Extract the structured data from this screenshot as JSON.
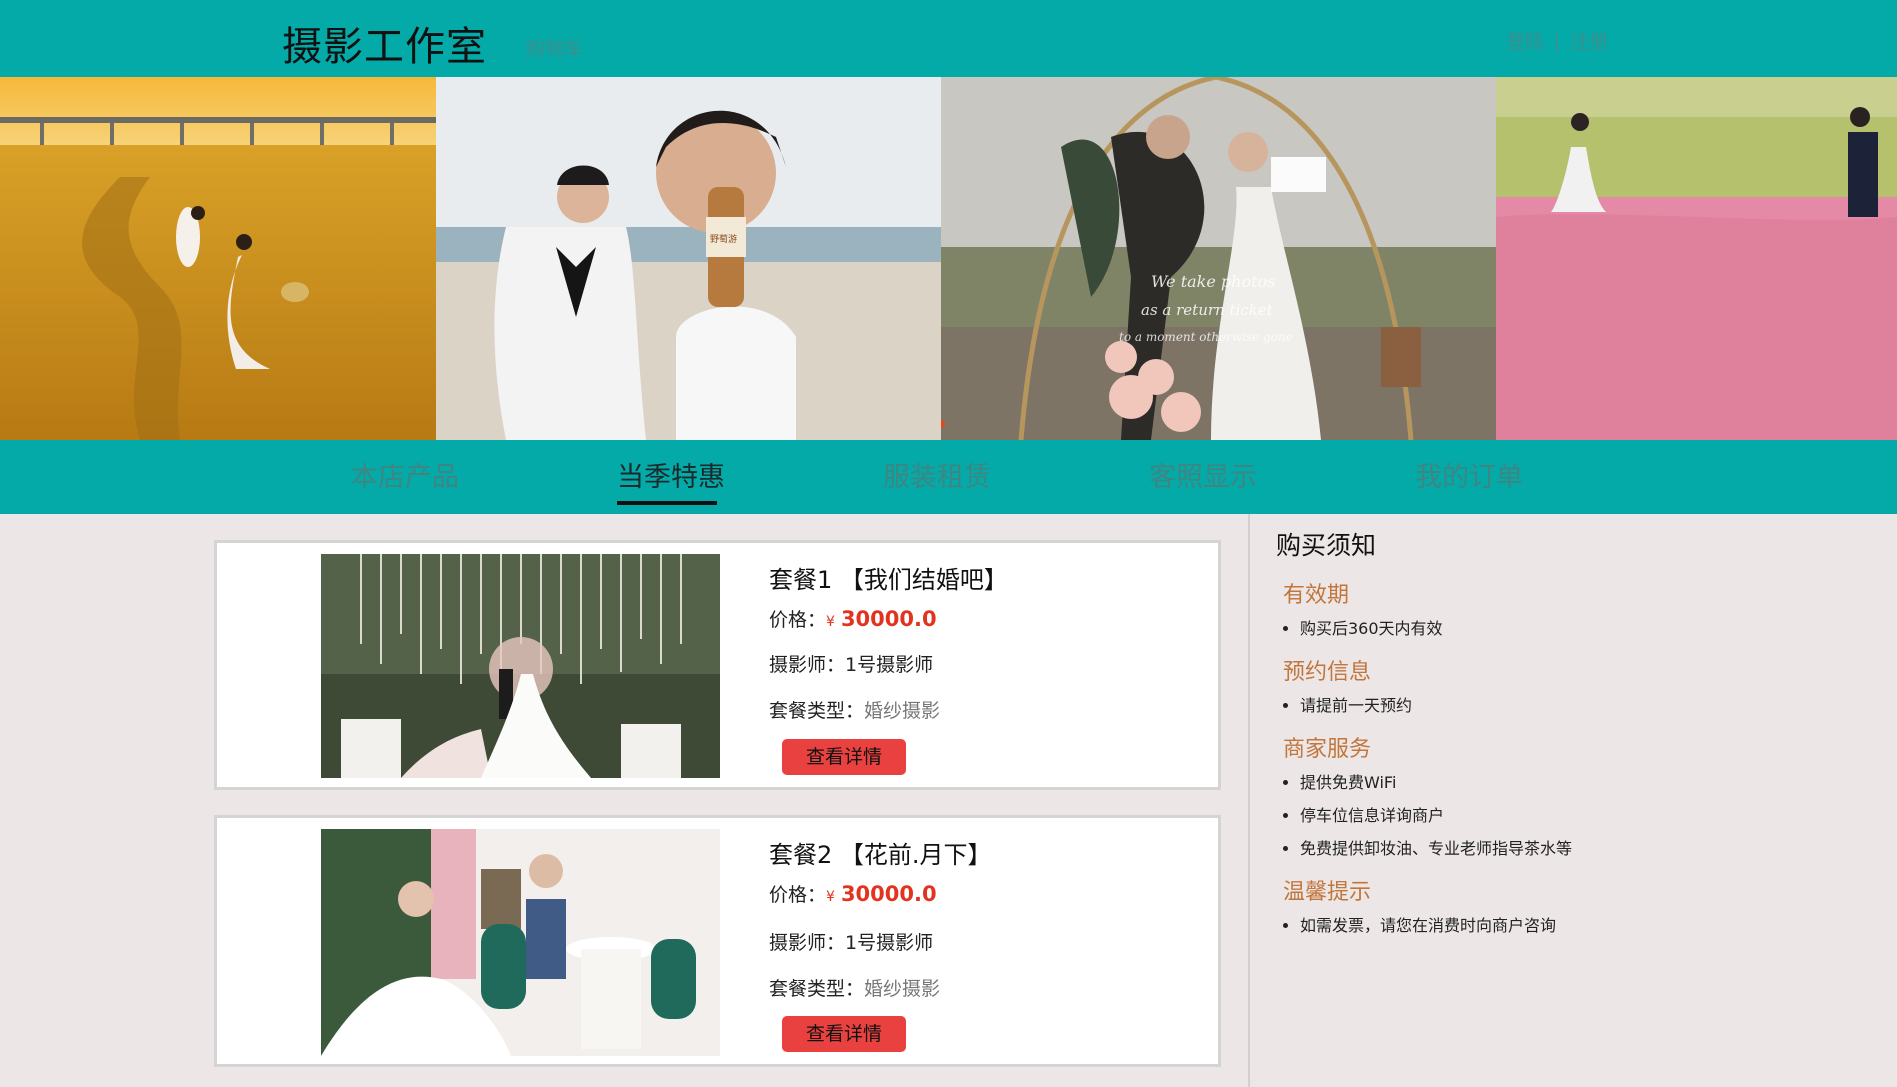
{
  "header": {
    "logo": "摄影工作室",
    "cart": "购物车",
    "login": "登陆",
    "separator": "|",
    "register": "注册"
  },
  "banner": {
    "slide_overlay_text": [
      "We take photos",
      "as a return ticket",
      "to a moment otherwise gone"
    ],
    "bottle_label": "野萄游",
    "carousel_dots": 5,
    "active_dot": 5
  },
  "nav": {
    "items": [
      "本店产品",
      "当季特惠",
      "服装租赁",
      "客照显示",
      "我的订单"
    ],
    "active": "当季特惠"
  },
  "packages": [
    {
      "title": "套餐1 【我们结婚吧】",
      "price_label": "价格：",
      "currency": "¥",
      "price": "30000.0",
      "photographer_label": "摄影师：",
      "photographer": "1号摄影师",
      "type_label": "套餐类型：",
      "type": "婚纱摄影",
      "button": "查看详情"
    },
    {
      "title": "套餐2 【花前.月下】",
      "price_label": "价格：",
      "currency": "¥",
      "price": "30000.0",
      "photographer_label": "摄影师：",
      "photographer": "1号摄影师",
      "type_label": "套餐类型：",
      "type": "婚纱摄影",
      "button": "查看详情"
    }
  ],
  "notice": {
    "title": "购买须知",
    "sections": [
      {
        "heading": "有效期",
        "items": [
          "购买后360天内有效"
        ]
      },
      {
        "heading": "预约信息",
        "items": [
          "请提前一天预约"
        ]
      },
      {
        "heading": "商家服务",
        "items": [
          "提供免费WiFi",
          "停车位信息详询商户",
          "免费提供卸妆油、专业老师指导茶水等"
        ]
      },
      {
        "heading": "温馨提示",
        "items": [
          "如需发票，请您在消费时向商户咨询"
        ]
      }
    ]
  },
  "colors": {
    "header_bg": "#04aaa8",
    "accent_price": "#e2331e",
    "button": "#e8413f",
    "section_heading": "#c2763c",
    "page_bg": "#ece7e6"
  }
}
